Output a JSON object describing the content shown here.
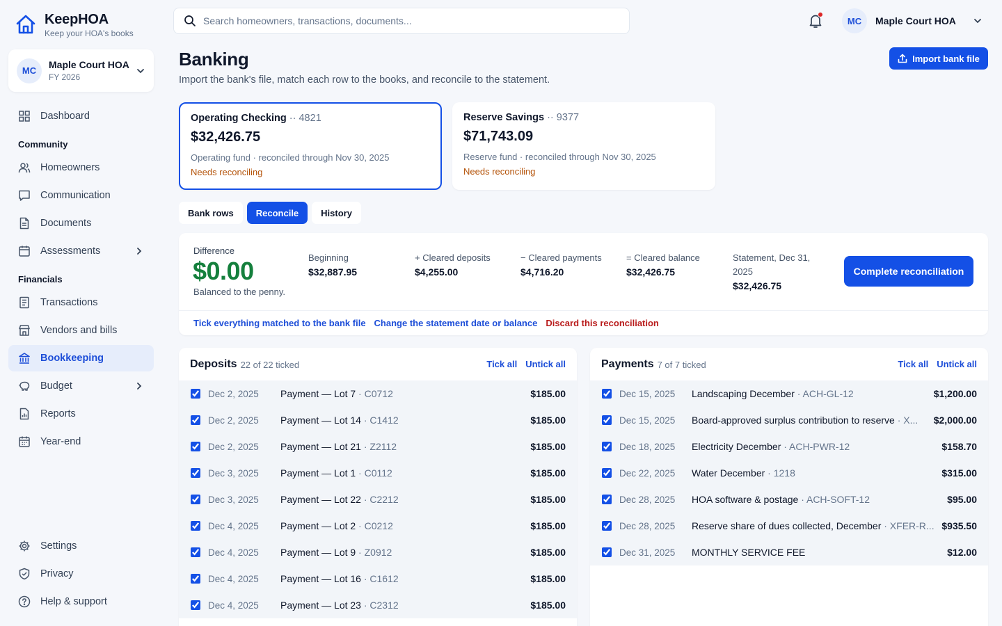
{
  "brand": {
    "name": "KeepHOA",
    "tagline": "Keep your HOA's books"
  },
  "org": {
    "initials": "MC",
    "name": "Maple Court HOA",
    "period": "FY 2026"
  },
  "nav": {
    "dashboard": "Dashboard",
    "community_heading": "Community",
    "homeowners": "Homeowners",
    "communication": "Communication",
    "documents": "Documents",
    "assessments": "Assessments",
    "financials_heading": "Financials",
    "transactions": "Transactions",
    "vendors": "Vendors and bills",
    "bookkeeping": "Bookkeeping",
    "budget": "Budget",
    "reports": "Reports",
    "yearend": "Year-end",
    "settings": "Settings",
    "privacy": "Privacy",
    "help": "Help & support"
  },
  "search": {
    "placeholder": "Search homeowners, transactions, documents..."
  },
  "user": {
    "initials": "MC",
    "name": "Maple Court HOA"
  },
  "page": {
    "title": "Banking",
    "subtitle": "Import the bank's file, match each row to the books, and reconcile to the statement.",
    "import_label": "Import bank file"
  },
  "accounts": [
    {
      "name": "Operating Checking",
      "number": " ·· 4821",
      "balance": "$32,426.75",
      "meta": "Operating fund · reconciled through Nov 30, 2025",
      "status": "Needs reconciling"
    },
    {
      "name": "Reserve Savings",
      "number": " ·· 9377",
      "balance": "$71,743.09",
      "meta": "Reserve fund · reconciled through Nov 30, 2025",
      "status": "Needs reconciling"
    }
  ],
  "tabs": [
    "Bank rows",
    "Reconcile",
    "History"
  ],
  "reconcile": {
    "difference_label": "Difference",
    "difference": "$0.00",
    "difference_note": "Balanced to the penny.",
    "stats": [
      {
        "label": "Beginning",
        "value": "$32,887.95"
      },
      {
        "label": "+ Cleared deposits",
        "value": "$4,255.00"
      },
      {
        "label": "− Cleared payments",
        "value": "$4,716.20"
      },
      {
        "label": "= Cleared balance",
        "value": "$32,426.75"
      },
      {
        "label": "Statement, Dec 31, 2025",
        "value": "$32,426.75"
      }
    ],
    "complete_label": "Complete reconciliation",
    "links": {
      "tick_matched": "Tick everything matched to the bank file",
      "change_statement": "Change the statement date or balance",
      "discard": "Discard this reconciliation"
    }
  },
  "deposits": {
    "title": "Deposits",
    "count": "22 of 22 ticked",
    "tick_all": "Tick all",
    "untick_all": "Untick all",
    "rows": [
      {
        "date": "Dec 2, 2025",
        "desc": "Payment — Lot 7",
        "ref": " · C0712",
        "amount": "$185.00"
      },
      {
        "date": "Dec 2, 2025",
        "desc": "Payment — Lot 14",
        "ref": " · C1412",
        "amount": "$185.00"
      },
      {
        "date": "Dec 2, 2025",
        "desc": "Payment — Lot 21",
        "ref": " · Z2112",
        "amount": "$185.00"
      },
      {
        "date": "Dec 3, 2025",
        "desc": "Payment — Lot 1",
        "ref": " · C0112",
        "amount": "$185.00"
      },
      {
        "date": "Dec 3, 2025",
        "desc": "Payment — Lot 22",
        "ref": " · C2212",
        "amount": "$185.00"
      },
      {
        "date": "Dec 4, 2025",
        "desc": "Payment — Lot 2",
        "ref": " · C0212",
        "amount": "$185.00"
      },
      {
        "date": "Dec 4, 2025",
        "desc": "Payment — Lot 9",
        "ref": " · Z0912",
        "amount": "$185.00"
      },
      {
        "date": "Dec 4, 2025",
        "desc": "Payment — Lot 16",
        "ref": " · C1612",
        "amount": "$185.00"
      },
      {
        "date": "Dec 4, 2025",
        "desc": "Payment — Lot 23",
        "ref": " · C2312",
        "amount": "$185.00"
      }
    ]
  },
  "payments": {
    "title": "Payments",
    "count": "7 of 7 ticked",
    "tick_all": "Tick all",
    "untick_all": "Untick all",
    "rows": [
      {
        "date": "Dec 15, 2025",
        "desc": "Landscaping December",
        "ref": " · ACH-GL-12",
        "amount": "$1,200.00"
      },
      {
        "date": "Dec 15, 2025",
        "desc": "Board-approved surplus contribution to reserve",
        "ref": " · X...",
        "amount": "$2,000.00"
      },
      {
        "date": "Dec 18, 2025",
        "desc": "Electricity December",
        "ref": " · ACH-PWR-12",
        "amount": "$158.70"
      },
      {
        "date": "Dec 22, 2025",
        "desc": "Water December",
        "ref": " · 1218",
        "amount": "$315.00"
      },
      {
        "date": "Dec 28, 2025",
        "desc": "HOA software & postage",
        "ref": " · ACH-SOFT-12",
        "amount": "$95.00"
      },
      {
        "date": "Dec 28, 2025",
        "desc": "Reserve share of dues collected, December",
        "ref": " · XFER-R...",
        "amount": "$935.50"
      },
      {
        "date": "Dec 31, 2025",
        "desc": "MONTHLY SERVICE FEE",
        "ref": "",
        "amount": "$12.00"
      }
    ]
  },
  "colors": {
    "accent": "#1450e6",
    "success": "#15803d",
    "warning": "#b45309",
    "danger": "#b91c1c"
  }
}
